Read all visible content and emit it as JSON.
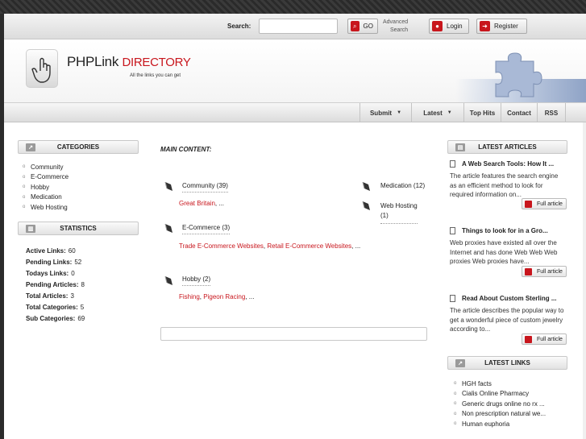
{
  "topbar": {
    "search_label": "Search:",
    "search_placeholder": "",
    "go_label": "GO",
    "advanced_line1": "Advanced",
    "advanced_line2": "Search",
    "login_label": "Login",
    "register_label": "Register"
  },
  "header": {
    "logo_main": "PHPLink",
    "logo_accent": "DIRECTORY",
    "tagline": "All the links you can get"
  },
  "nav": {
    "submit": "Submit",
    "latest": "Latest",
    "top_hits": "Top Hits",
    "contact": "Contact",
    "rss": "RSS"
  },
  "categories": {
    "title": "CATEGORIES",
    "items": [
      "Community",
      "E-Commerce",
      "Hobby",
      "Medication",
      "Web Hosting"
    ]
  },
  "statistics": {
    "title": "STATISTICS",
    "rows": [
      {
        "label": "Active Links:",
        "value": "60"
      },
      {
        "label": "Pending Links:",
        "value": "52"
      },
      {
        "label": "Todays Links:",
        "value": "0"
      },
      {
        "label": "Pending Articles:",
        "value": "8"
      },
      {
        "label": "Total Articles:",
        "value": "3"
      },
      {
        "label": "Total Categories:",
        "value": "5"
      },
      {
        "label": "Sub Categories:",
        "value": "69"
      }
    ]
  },
  "main": {
    "title": "MAIN CONTENT",
    "title_suffix": ":",
    "categories": [
      {
        "name": "Community (39)",
        "subs": [
          "Great Britain"
        ],
        "ellipsis": ", ..."
      },
      {
        "name": "E-Commerce (3)",
        "subs": [
          "Trade E-Commerce Websites",
          "Retail E-Commerce Websites"
        ],
        "ellipsis": ", ..."
      },
      {
        "name": "Hobby (2)",
        "subs": [
          "Fishing",
          "Pigeon Racing"
        ],
        "ellipsis": ", ..."
      },
      {
        "name": "Medication (12)"
      },
      {
        "name_line1": "Web Hosting",
        "name_line2": "(1)"
      }
    ]
  },
  "articles": {
    "title": "LATEST ARTICLES",
    "full_label": "Full article",
    "items": [
      {
        "title": "A Web Search Tools: How It ...",
        "body": [
          "The article features the search engine",
          "as an efficient method to look for",
          "required information on..."
        ]
      },
      {
        "title": "Things to look for in a Gro...",
        "body": [
          "Web proxies have existed all over the",
          "Internet and has done Web Web Web",
          "proxies Web proxies have..."
        ]
      },
      {
        "title": "Read About Custom Sterling ...",
        "body": [
          "The article describes the popular way to",
          "get a wonderful piece of custom jewelry",
          "according to..."
        ]
      }
    ]
  },
  "latest_links": {
    "title": "LATEST LINKS",
    "items": [
      "HGH facts",
      "Cialis Online Pharmacy",
      "Generic drugs online no rx ...",
      "Non prescription natural we...",
      "Human euphoria"
    ]
  },
  "colors": {
    "accent": "#c8161d",
    "nav_bg": "#e6e6e6",
    "dark_bg": "#2b2b2b"
  }
}
